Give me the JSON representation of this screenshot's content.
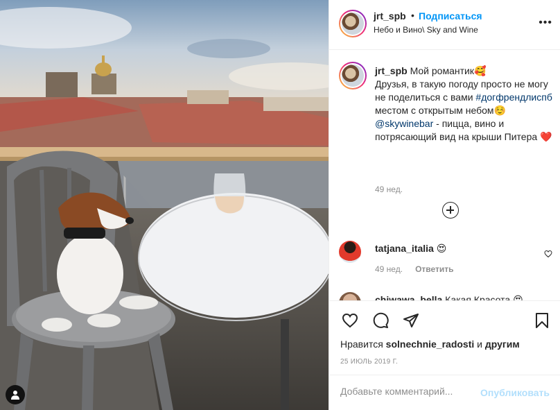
{
  "post": {
    "username": "jrt_spb",
    "separator": "•",
    "follow_label": "Подписаться",
    "location": "Небо и Вино\\ Sky and Wine",
    "more_label": "•••"
  },
  "caption": {
    "username": "jrt_spb",
    "line1": " Мой романтик🥰",
    "line2": "Друзья, в такую погоду просто не могу не поделиться с вами ",
    "hashtag": "#догфрендлиспб",
    "line3": " местом с открытым небом☺️",
    "mention": "@skywinebar",
    "line4": " - пицца, вино и потрясающий вид на крыши Питера ❤️",
    "time": "49 нед."
  },
  "comments": [
    {
      "username": "tatjana_italia",
      "text": " 😍",
      "time": "49 нед.",
      "reply_label": "Ответить"
    },
    {
      "username": "chiwawa_bella",
      "text": " Какая Красота 😍"
    }
  ],
  "likes": {
    "prefix": "Нравится ",
    "user": "solnechnie_radosti",
    "middle": " и ",
    "others": "другим"
  },
  "date": "25 ИЮЛЬ 2019 Г.",
  "add_comment": {
    "placeholder": "Добавьте комментарий...",
    "post_label": "Опубликовать"
  },
  "icons": [
    "user-tag-icon",
    "heart-icon",
    "comment-icon",
    "share-icon",
    "bookmark-icon",
    "add-more-comments-icon"
  ],
  "colors": {
    "link": "#0095f6",
    "hashtag": "#00376b",
    "post_disabled": "#b2dffc",
    "meta": "#8e8e8e"
  }
}
